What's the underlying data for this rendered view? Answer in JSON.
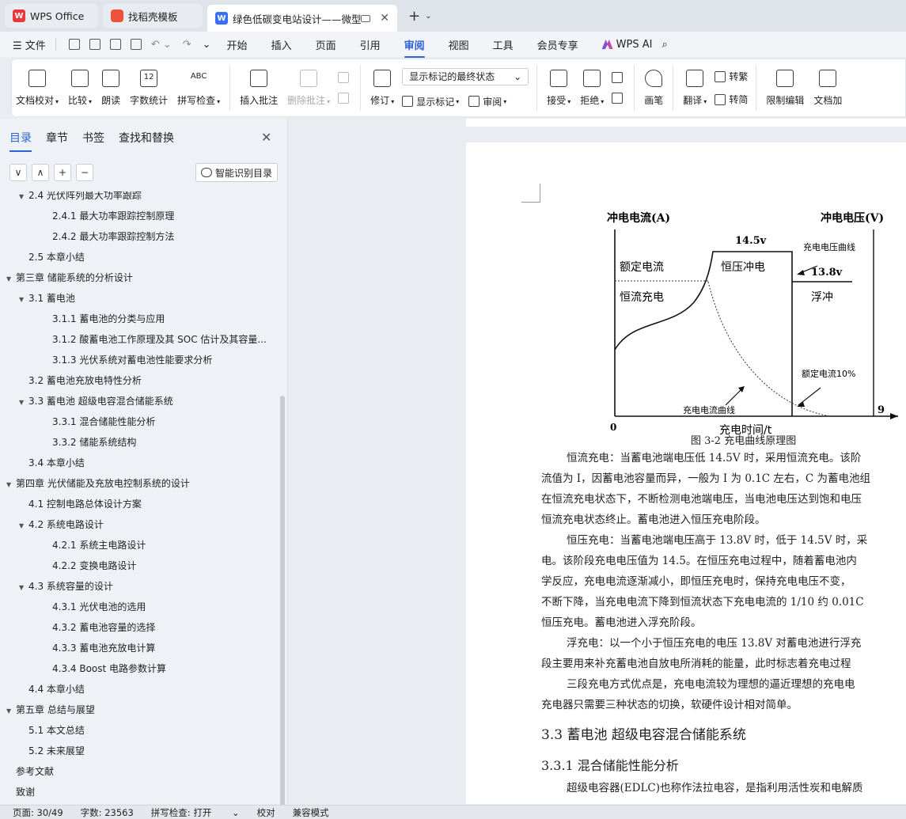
{
  "tabs": [
    {
      "label": "WPS Office",
      "logo": "W"
    },
    {
      "label": "找稻壳模板"
    },
    {
      "label": "绿色低碳变电站设计——微型",
      "logo": "W"
    }
  ],
  "menu": {
    "file": "文件",
    "items": [
      "开始",
      "插入",
      "页面",
      "引用",
      "审阅",
      "视图",
      "工具",
      "会员专享"
    ],
    "active": "审阅",
    "ai": "WPS AI"
  },
  "ribbon": {
    "doc_check": "文档校对",
    "compare": "比较",
    "read_aloud": "朗读",
    "word_count": "字数统计",
    "word_count_icon": "12",
    "spell_check": "拼写检查",
    "spell_check_icon": "ABC",
    "insert_comment": "插入批注",
    "delete_comment": "删除批注",
    "revise": "修订",
    "markup_select": "显示标记的最终状态",
    "show_markup": "显示标记",
    "review": "审阅",
    "accept": "接受",
    "reject": "拒绝",
    "pen": "画笔",
    "translate": "翻译",
    "to_trad": "转繁",
    "to_simp": "转简",
    "restrict_edit": "限制编辑",
    "doc_encrypt": "文档加"
  },
  "nav": {
    "tabs": [
      "目录",
      "章节",
      "书签",
      "查找和替换"
    ],
    "smart_toc": "智能识别目录",
    "controls": [
      "∨",
      "∧",
      "+",
      "−"
    ],
    "toc": [
      {
        "text": "2.4 光伏阵列最大功率跟踪",
        "level": 2,
        "arrow": true
      },
      {
        "text": "2.4.1 最大功率跟踪控制原理",
        "level": 3
      },
      {
        "text": "2.4.2  最大功率跟踪控制方法",
        "level": 3
      },
      {
        "text": "2.5  本章小结",
        "level": 2
      },
      {
        "text": "第三章  储能系统的分析设计",
        "level": 1,
        "arrow": true
      },
      {
        "text": "3.1  蓄电池",
        "level": 2,
        "arrow": true
      },
      {
        "text": "3.1.1 蓄电池的分类与应用",
        "level": 3
      },
      {
        "text": "3.1.2 酸蓄电池工作原理及其 SOC 估计及其容量...",
        "level": 3
      },
      {
        "text": "3.1.3  光伏系统对蓄电池性能要求分析",
        "level": 3
      },
      {
        "text": "3.2 蓄电池充放电特性分析",
        "level": 2
      },
      {
        "text": "3.3  蓄电池  超级电容混合储能系统",
        "level": 2,
        "arrow": true
      },
      {
        "text": "3.3.1  混合储能性能分析",
        "level": 3
      },
      {
        "text": "3.3.2  储能系统结构",
        "level": 3
      },
      {
        "text": "3.4 本章小结",
        "level": 2
      },
      {
        "text": "第四章  光伏储能及充放电控制系统的设计",
        "level": 1,
        "arrow": true
      },
      {
        "text": "4.1 控制电路总体设计方案",
        "level": 2
      },
      {
        "text": "4.2 系统电路设计",
        "level": 2,
        "arrow": true
      },
      {
        "text": "4.2.1 系统主电路设计",
        "level": 3
      },
      {
        "text": "4.2.2  变换电路设计",
        "level": 3
      },
      {
        "text": "4.3 系统容量的设计",
        "level": 2,
        "arrow": true
      },
      {
        "text": "4.3.1 光伏电池的选用",
        "level": 3
      },
      {
        "text": "4.3.2 蓄电池容量的选择",
        "level": 3
      },
      {
        "text": "4.3.3 蓄电池充放电计算",
        "level": 3
      },
      {
        "text": "4.3.4 Boost 电路参数计算",
        "level": 3
      },
      {
        "text": "4.4 本章小结",
        "level": 2
      },
      {
        "text": "第五章  总结与展望",
        "level": 1,
        "arrow": true
      },
      {
        "text": "5.1  本文总结",
        "level": 2
      },
      {
        "text": "5.2 未来展望",
        "level": 2
      },
      {
        "text": "参考文献",
        "level": 1
      },
      {
        "text": "致谢",
        "level": 1
      }
    ]
  },
  "figure": {
    "y_left": "冲电电流(A)",
    "y_right": "冲电电压(V)",
    "v_peak": "14.5v",
    "v_float": "13.8v",
    "voltage_curve": "充电电压曲线",
    "rated_current": "额定电流",
    "const_current": "恒流充电",
    "const_voltage": "恒压冲电",
    "float": "浮冲",
    "rated_10": "额定电流10%",
    "current_curve": "充电电流曲线",
    "x_label": "充电时间/t",
    "origin": "0",
    "x_end": "9",
    "caption": "图 3-2  充电曲线原理图"
  },
  "doc": {
    "p1": [
      "恒流充电：当蓄电池端电压低 14.5V 时，采用恒流充电。该阶",
      "流值为 I，因蓄电池容量而异，一般为 I 为 0.1C 左右，C 为蓄电池组",
      "在恒流充电状态下，不断检测电池端电压，当电池电压达到饱和电压",
      "恒流充电状态终止。蓄电池进入恒压充电阶段。"
    ],
    "p2": [
      "恒压充电：当蓄电池端电压高于 13.8V 时，低于 14.5V 时，采",
      "电。该阶段充电电压值为 14.5。在恒压充电过程中，随着蓄电池内",
      "学反应，充电电流逐渐减小，即恒压充电时，保持充电电压不变，",
      "不断下降，当充电电流下降到恒流状态下充电电流的 1/10 约 0.01C",
      "恒压充电。蓄电池进入浮充阶段。"
    ],
    "p3": [
      "浮充电：以一个小于恒压充电的电压 13.8V 对蓄电池进行浮充",
      "段主要用来补充蓄电池自放电所消耗的能量，此时标志着充电过程"
    ],
    "p4": [
      "三段充电方式优点是，充电电流较为理想的逼近理想的充电电",
      "充电器只需要三种状态的切换，软硬件设计相对简单。"
    ],
    "h_33": "3.3  蓄电池  超级电容混合储能系统",
    "h_331": "3.3.1  混合储能性能分析",
    "p5": "超级电容器(EDLC)也称作法拉电容，是指利用活性炭和电解质"
  },
  "status": {
    "page": "页面: 30/49",
    "words": "字数: 23563",
    "spell": "拼写检查: 打开",
    "proof": "校对",
    "compat": "兼容模式"
  }
}
